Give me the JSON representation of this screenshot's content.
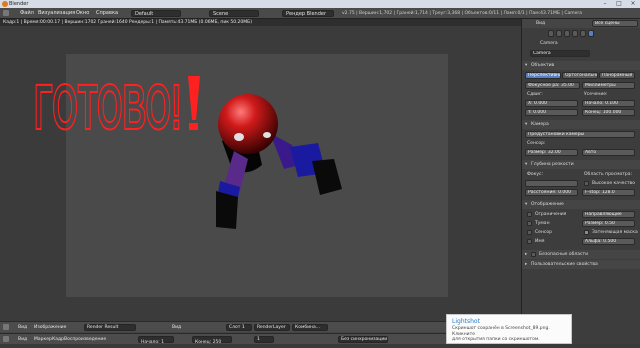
{
  "window": {
    "title": "Blender"
  },
  "infobar": {
    "menus": [
      "Файл",
      "Визуализация",
      "Окно",
      "Справка"
    ],
    "layout": "Default",
    "scene": "Scene",
    "engine": "Рендер Blender",
    "stats": "v2.75 | Вершин:1,702 | Граней:1,714 | Треуг:3,368 | Объектов:0/11 | Ламп:0/1 | Пам:43.71МБ | Camera"
  },
  "viewport": {
    "header": "Кадр:1 | Время:00:00.17 | Вершин:1702 Граней:1640 Рендеры:1 | Память:43.71МБ (0.06МБ, пик 50.20МБ)",
    "canvas_text": "ГОТОВО!"
  },
  "bottom_bar1": {
    "view": "Вид",
    "image": "Изображение",
    "result": "Render Result",
    "view2": "Вид",
    "slot": "Слот 1",
    "layer": "RenderLayer",
    "combined": "Комбина..."
  },
  "bottom_bar2": {
    "view": "Вид",
    "marker": "Маркер",
    "frame": "Кадр",
    "playback": "Воспроизведение",
    "start_label": "Начало:",
    "start_value": "1",
    "end_label": "Конец:",
    "end_value": "250",
    "current": "1",
    "sync": "Без синхронизации"
  },
  "props": {
    "view_label": "Вид",
    "search_label": "Все сцены",
    "breadcrumb": "Camera",
    "name_value": "Camera",
    "lens_section": "Объектив",
    "tabs": [
      "Перспективный",
      "Ортогональный",
      "Панорамный"
    ],
    "focal_label": "Фокусное ра:",
    "focal_value": "35.00",
    "units_value": "Миллиметры",
    "shift_label": "Сдвиг:",
    "clip_label": "Усечение:",
    "shift_x_label": "X:",
    "shift_x_value": "0.000",
    "shift_y_label": "Y:",
    "shift_y_value": "0.000",
    "clip_start_label": "Начало:",
    "clip_start_value": "0.100",
    "clip_end_label": "Конец:",
    "clip_end_value": "100.000",
    "camera_section": "Камера",
    "presets": "Предустановки камеры",
    "sensor_label": "Сенсор:",
    "sensor_size_label": "Размер:",
    "sensor_size_value": "32.00",
    "sensor_fit": "Авто",
    "dof_section": "Глубина резкости",
    "focus_label": "Фокус:",
    "viewport_label": "Область просмотра:",
    "high_quality_label": "Высокое качество",
    "distance_label": "Расстояние:",
    "distance_value": "0.000",
    "fstop_label": "F-stop:",
    "fstop_value": "128.0",
    "display_section": "Отображение",
    "limits_label": "Ограничения",
    "guides_value": "Направляющие",
    "mist_label": "Туман",
    "sensor_check_label": "Сенсор",
    "name_check_label": "Имя",
    "size_label": "Размер:",
    "size_value": "0.50",
    "passepartout_label": "Затеняющая маска",
    "alpha_label": "Альфа:",
    "alpha_value": "0.500",
    "safe_areas": "Безопасные области",
    "custom_props": "Пользовательские свойства"
  },
  "toast": {
    "title": "Lightshot",
    "line1": "Скриншот сохранён в Screenshot_89.png. Кликните",
    "line2": "для открытия папки со скриншотом."
  },
  "colors": {
    "text_red": "#ff2020",
    "ball_red": "#c01818",
    "arm_blue": "#1a1aa0",
    "arm_purple": "#5a2a8a",
    "accent": "#5680c2"
  }
}
